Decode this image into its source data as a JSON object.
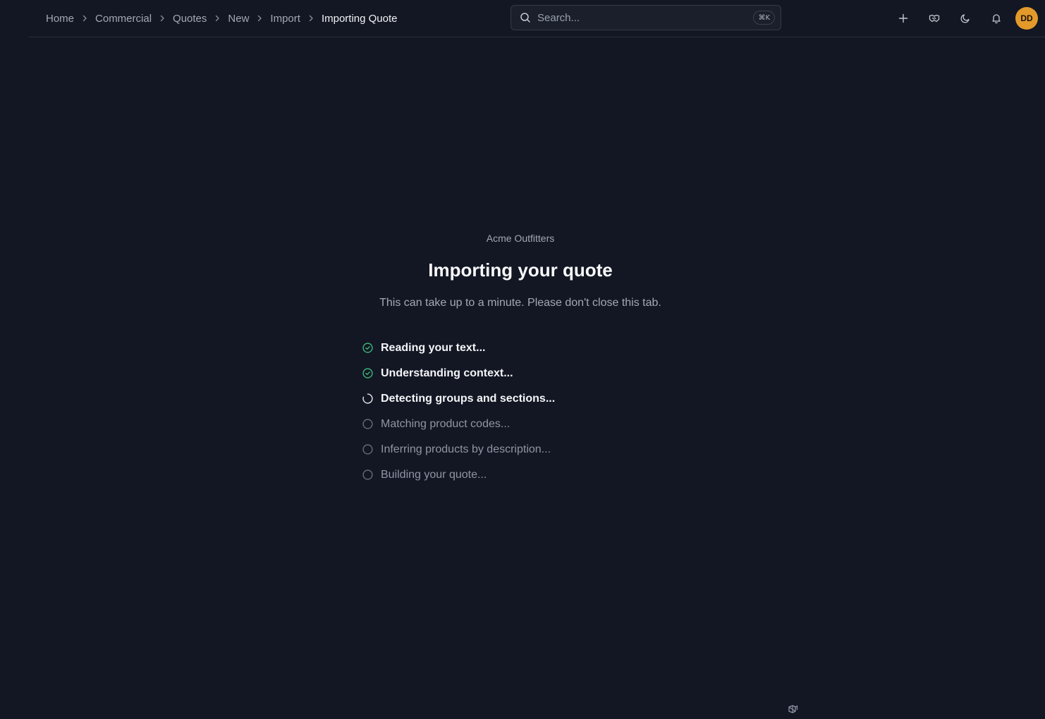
{
  "breadcrumb": {
    "items": [
      "Home",
      "Commercial",
      "Quotes",
      "New",
      "Import"
    ],
    "current": "Importing Quote"
  },
  "search": {
    "placeholder": "Search...",
    "shortcut": "⌘K"
  },
  "user": {
    "initials": "DD",
    "avatar_color": "#e39a2a"
  },
  "import": {
    "company": "Acme Outfitters",
    "title": "Importing your quote",
    "subtitle": "This can take up to a minute. Please don't close this tab.",
    "steps": [
      {
        "label": "Reading your text...",
        "status": "done"
      },
      {
        "label": "Understanding context...",
        "status": "done"
      },
      {
        "label": "Detecting groups and sections...",
        "status": "in-progress"
      },
      {
        "label": "Matching product codes...",
        "status": "pending"
      },
      {
        "label": "Inferring products by description...",
        "status": "pending"
      },
      {
        "label": "Building your quote...",
        "status": "pending"
      }
    ]
  },
  "colors": {
    "background": "#131723",
    "done": "#3fbf7f",
    "pending": "#6b7180",
    "accent": "#e39a2a"
  },
  "icons": [
    "search-icon",
    "plus-icon",
    "handshake-icon",
    "moon-icon",
    "bell-icon",
    "check-circle-icon",
    "spinner-icon",
    "empty-circle-icon",
    "logo-icon"
  ]
}
